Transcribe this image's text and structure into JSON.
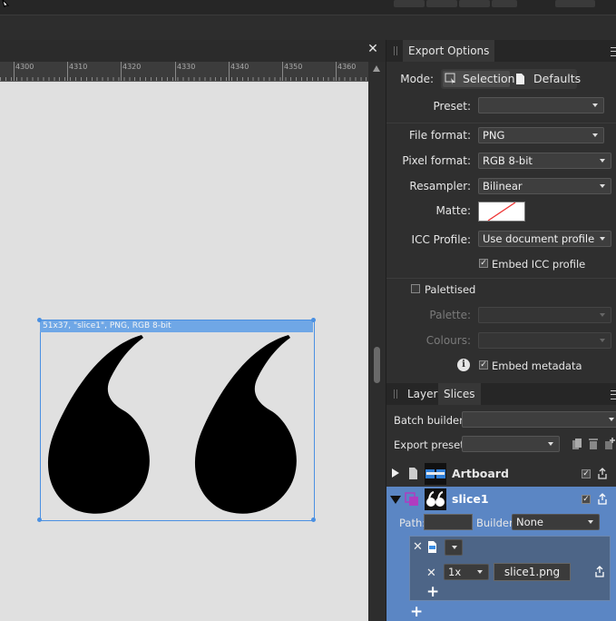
{
  "export_options": {
    "tab": "Export Options",
    "mode_label": "Mode:",
    "mode_selection": "Selection",
    "mode_defaults": "Defaults",
    "preset_label": "Preset:",
    "preset_value": "",
    "file_format_label": "File format:",
    "file_format_value": "PNG",
    "pixel_format_label": "Pixel format:",
    "pixel_format_value": "RGB 8-bit",
    "resampler_label": "Resampler:",
    "resampler_value": "Bilinear",
    "matte_label": "Matte:",
    "icc_label": "ICC Profile:",
    "icc_value": "Use document profile",
    "embed_icc_label": "Embed ICC profile",
    "embed_icc_checked": true,
    "palettised_label": "Palettised",
    "palettised_checked": false,
    "palette_label": "Palette:",
    "colours_label": "Colours:",
    "embed_metadata_label": "Embed metadata",
    "embed_metadata_checked": true
  },
  "slices_panel": {
    "tab_layers": "Layers",
    "tab_slices": "Slices",
    "batch_builder_label": "Batch builder:",
    "export_preset_label": "Export preset:",
    "artboard_name": "Artboard",
    "slice_name": "slice1",
    "path_label": "Path:",
    "builder_label": "Builder:",
    "builder_value": "None",
    "scale_value": "1x",
    "file_name": "slice1.png",
    "add_symbol": "+"
  },
  "canvas": {
    "slice_info": "51x37, \"slice1\", PNG, RGB 8-bit",
    "ruler_ticks": [
      "4300",
      "4310",
      "4320",
      "4330",
      "4340",
      "4350",
      "4360"
    ]
  },
  "colors": {
    "accent": "#4a90e2",
    "selected_row": "#5b86c4",
    "canvas_bg": "#e0e0e0"
  }
}
